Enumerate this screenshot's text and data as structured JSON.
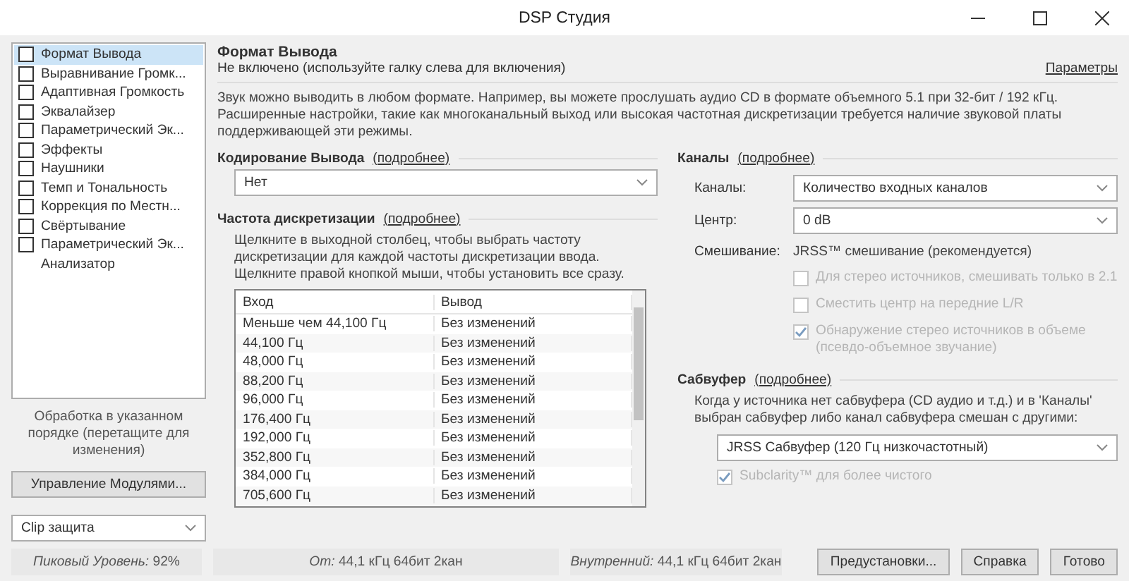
{
  "window": {
    "title": "DSP Студия"
  },
  "sidebar": {
    "items": [
      {
        "kind": "checkbox",
        "label": "Формат Вывода",
        "checked": false,
        "selected": true
      },
      {
        "kind": "checkbox",
        "label": "Выравнивание Громк...",
        "checked": false,
        "selected": false
      },
      {
        "kind": "checkbox",
        "label": "Адаптивная Громкость",
        "checked": false,
        "selected": false
      },
      {
        "kind": "checkbox",
        "label": "Эквалайзер",
        "checked": false,
        "selected": false
      },
      {
        "kind": "checkbox",
        "label": "Параметрический Эк...",
        "checked": false,
        "selected": false
      },
      {
        "kind": "checkbox",
        "label": "Эффекты",
        "checked": false,
        "selected": false
      },
      {
        "kind": "checkbox",
        "label": "Наушники",
        "checked": false,
        "selected": false
      },
      {
        "kind": "checkbox",
        "label": "Темп и Тональность",
        "checked": false,
        "selected": false
      },
      {
        "kind": "checkbox",
        "label": "Коррекция по Местн...",
        "checked": false,
        "selected": false
      },
      {
        "kind": "checkbox",
        "label": "Свёртывание",
        "checked": false,
        "selected": false
      },
      {
        "kind": "checkbox",
        "label": "Параметрический Эк...",
        "checked": false,
        "selected": false
      },
      {
        "kind": "plain",
        "label": "Анализатор",
        "selected": false
      }
    ],
    "note": "Обработка в указанном порядке (перетащите для изменения)",
    "manage_button": "Управление Модулями...",
    "clip_dropdown": "Clip защита"
  },
  "header": {
    "title": "Формат Вывода",
    "subtitle": "Не включено (используйте галку слева для включения)",
    "link": "Параметры"
  },
  "description": "Звук можно выводить в любом формате. Например, вы можете прослушать аудио CD в формате объемного 5.1 при 32-бит / 192 кГц. Расширенные настройки, такие как многоканальный выход или высокая частотная дискретизации требуется наличие звуковой платы поддерживающей эти режимы.",
  "encoding": {
    "title": "Кодирование Вывода",
    "more": "(подробнее)",
    "value": "Нет"
  },
  "sample_rate": {
    "title": "Частота дискретизации",
    "more": "(подробнее)",
    "hint": "Щелкните в выходной столбец, чтобы выбрать частоту дискретизации для каждой частоты дискретизации ввода. Щелкните правой кнопкой мыши, чтобы установить все сразу.",
    "table": {
      "columns": [
        "Вход",
        "Вывод"
      ],
      "rows": [
        [
          "Меньше чем 44,100 Гц",
          "Без изменений"
        ],
        [
          "44,100 Гц",
          "Без изменений"
        ],
        [
          "48,000 Гц",
          "Без изменений"
        ],
        [
          "88,200 Гц",
          "Без изменений"
        ],
        [
          "96,000 Гц",
          "Без изменений"
        ],
        [
          "176,400 Гц",
          "Без изменений"
        ],
        [
          "192,000 Гц",
          "Без изменений"
        ],
        [
          "352,800 Гц",
          "Без изменений"
        ],
        [
          "384,000 Гц",
          "Без изменений"
        ],
        [
          "705,600 Гц",
          "Без изменений"
        ]
      ]
    }
  },
  "channels": {
    "title": "Каналы",
    "more": "(подробнее)",
    "fields": [
      {
        "label": "Каналы:",
        "value": "Количество входных каналов"
      },
      {
        "label": "Центр:",
        "value": "0 dB"
      }
    ],
    "mixing": {
      "label": "Смешивание:",
      "value": "JRSS™ смешивание (рекомендуется)"
    },
    "options": [
      {
        "label": "Для стерео источников, смешивать только в 2.1",
        "checked": false,
        "disabled": true
      },
      {
        "label": "Сместить центр на передние L/R",
        "checked": false,
        "disabled": true
      },
      {
        "label": "Обнаружение стерео источников в объеме (псевдо-объемное звучание)",
        "checked": true,
        "disabled": true
      }
    ]
  },
  "subwoofer": {
    "title": "Сабвуфер",
    "more": "(подробнее)",
    "hint": "Когда у источника нет сабвуфера (CD аудио и т.д.) и в 'Каналы' выбран сабвуфер либо канал сабвуфера смешан с другими:",
    "value": "JRSS Сабвуфер (120 Гц низкочастотный)",
    "option": {
      "label": "Subclarity™ для более чистого",
      "checked": true,
      "disabled": true
    }
  },
  "status_bar": [
    "*Пиковый Уровень:* 92%",
    "*От:* 44,1 кГц 64бит 2кан",
    "*Внутренний:* 44,1 кГц 64бит 2кан"
  ],
  "buttons": [
    "Предустановки...",
    "Справка",
    "Готово"
  ]
}
